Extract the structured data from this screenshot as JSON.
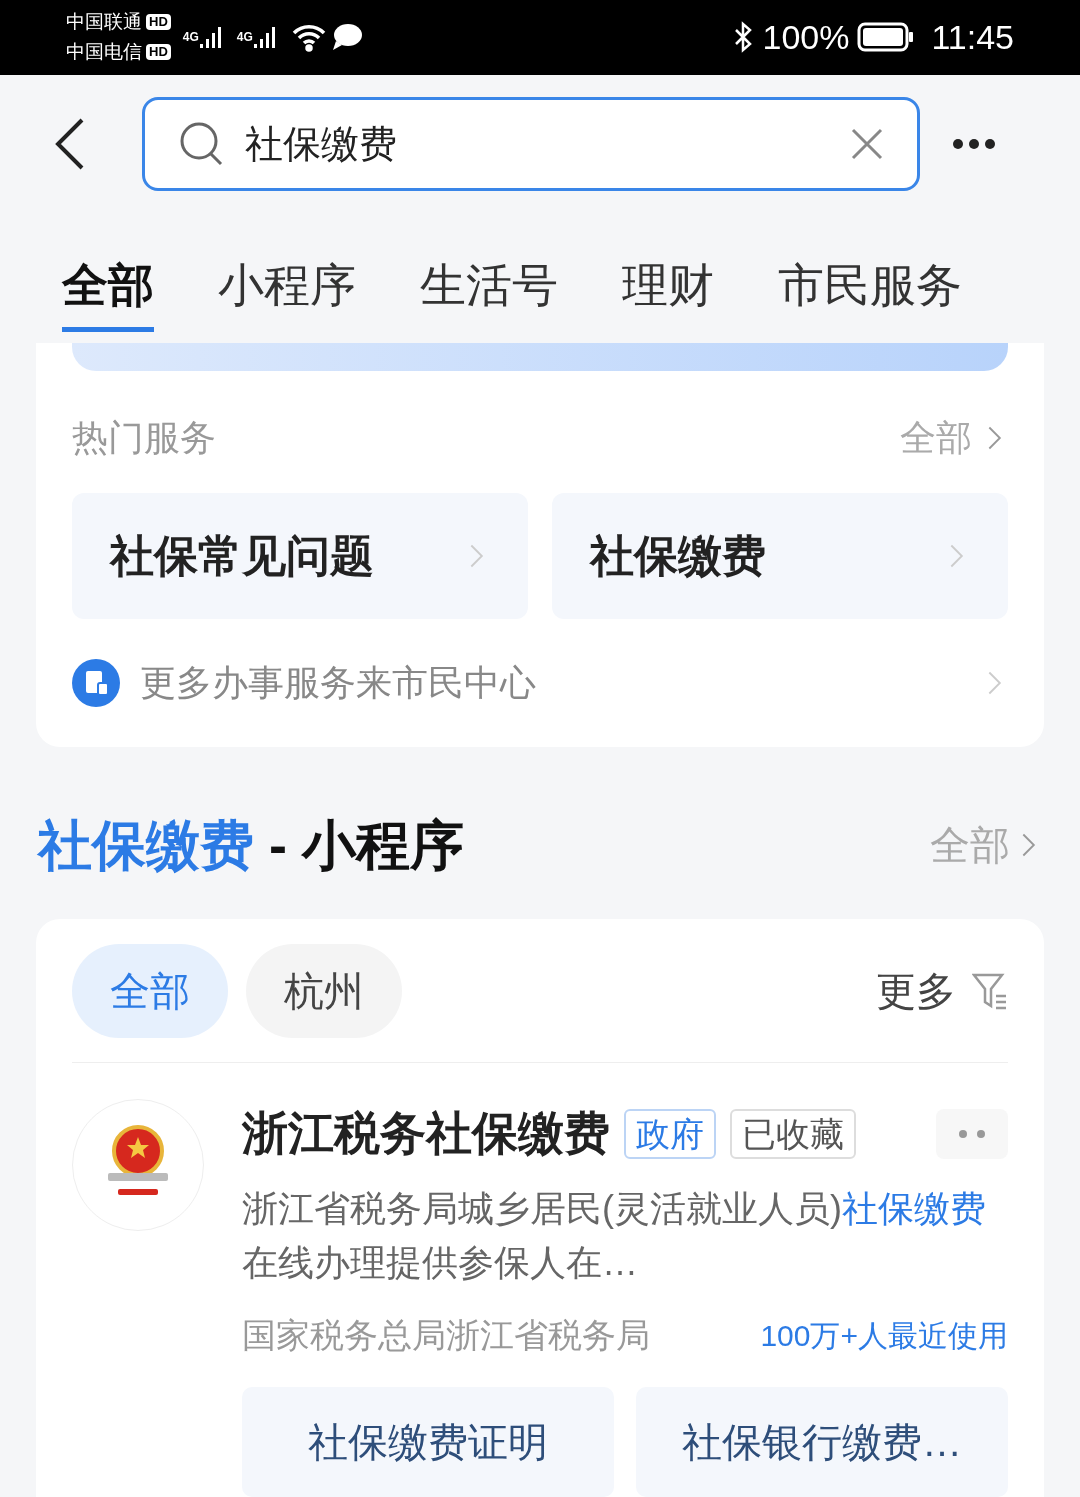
{
  "status_bar": {
    "carriers": [
      {
        "name": "中国联通",
        "badge": "HD"
      },
      {
        "name": "中国电信",
        "badge": "HD"
      }
    ],
    "network": [
      "4G",
      "4G"
    ],
    "battery": "100%",
    "time": "11:45"
  },
  "search": {
    "value": "社保缴费"
  },
  "tabs": [
    {
      "label": "全部",
      "selected": true
    },
    {
      "label": "小程序",
      "selected": false
    },
    {
      "label": "生活号",
      "selected": false
    },
    {
      "label": "理财",
      "selected": false
    },
    {
      "label": "市民服务",
      "selected": false
    }
  ],
  "hot_services": {
    "title": "热门服务",
    "all_link": "全部",
    "items": [
      "社保常见问题",
      "社保缴费"
    ],
    "more": "更多办事服务来市民中心"
  },
  "section": {
    "keyword": "社保缴费",
    "suffix": " - 小程序",
    "all_link": "全部"
  },
  "filters": [
    {
      "label": "全部",
      "selected": true
    },
    {
      "label": "杭州",
      "selected": false
    }
  ],
  "more_filter": "更多",
  "result": {
    "name": "浙江税务社保缴费",
    "tags": [
      {
        "label": "政府",
        "kind": "official"
      },
      {
        "label": "已收藏",
        "kind": "plain"
      }
    ],
    "description": [
      {
        "text": "浙江省税务局城乡居民(灵活就业人员)",
        "highlight": false
      },
      {
        "text": "社保缴费",
        "highlight": true
      },
      {
        "text": "在线办理提供参保人在…",
        "highlight": false
      }
    ],
    "provider": "国家税务总局浙江省税务局",
    "usage": "100万+人最近使用",
    "actions": [
      "社保缴费证明",
      "社保银行缴费…"
    ]
  }
}
